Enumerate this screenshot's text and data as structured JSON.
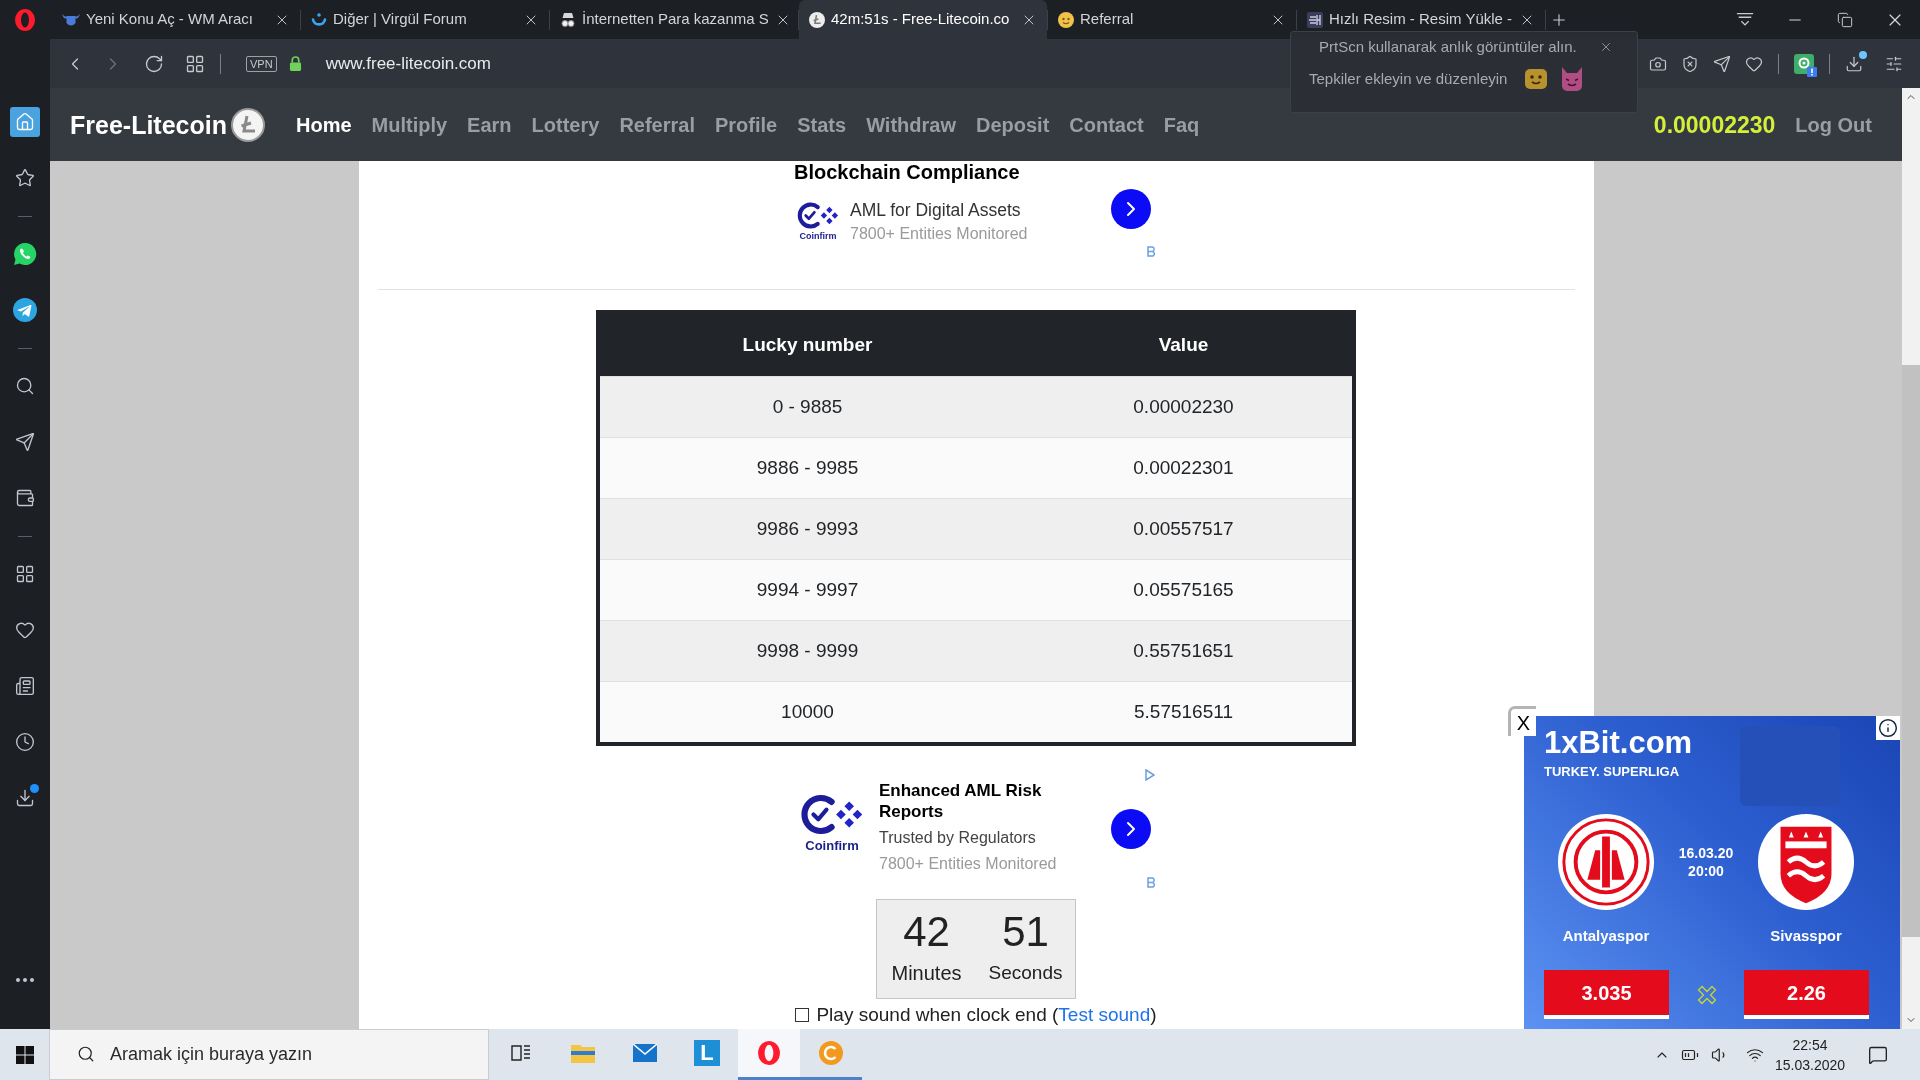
{
  "browser": {
    "tabs": [
      {
        "title": "Yeni Konu Aç - WM Aracı",
        "selected": false
      },
      {
        "title": "Diğer | Virgül Forum",
        "selected": false
      },
      {
        "title": "İnternetten Para kazanma S",
        "selected": false
      },
      {
        "title": "42m:51s - Free-Litecoin.co",
        "selected": true
      },
      {
        "title": "Referral",
        "selected": false
      },
      {
        "title": "Hızlı Resim - Resim Yükle -",
        "selected": false
      }
    ],
    "address_bar": {
      "vpn": "VPN",
      "url": "www.free-litecoin.com"
    },
    "toolbar": [
      [
        {
          "kind": "camera",
          "badge": false
        },
        {
          "kind": "adblock",
          "badge": false
        },
        {
          "kind": "send",
          "badge": false
        },
        {
          "kind": "heart",
          "badge": false
        }
      ],
      [
        {
          "kind": "extension",
          "badge": true
        }
      ],
      [
        {
          "kind": "download",
          "badge": true
        },
        {
          "kind": "settings",
          "badge": false
        }
      ]
    ],
    "popup": {
      "line_1": "PrtScn kullanarak anlık görüntüler alın.",
      "line_2": "Tepkiler ekleyin ve düzenleyin"
    },
    "sidebar": [
      [
        {
          "kind": "home",
          "selected": true,
          "badge": false
        },
        {
          "kind": "star",
          "selected": false,
          "badge": false
        }
      ],
      [
        {
          "kind": "whatsapp",
          "selected": false,
          "badge": false
        },
        {
          "kind": "telegram",
          "selected": false,
          "badge": false
        }
      ],
      [
        {
          "kind": "search",
          "selected": false,
          "badge": false
        },
        {
          "kind": "send",
          "selected": false,
          "badge": false
        },
        {
          "kind": "wallet",
          "selected": false,
          "badge": false
        }
      ],
      [
        {
          "kind": "grid",
          "selected": false,
          "badge": false
        },
        {
          "kind": "heart",
          "selected": false,
          "badge": false
        },
        {
          "kind": "news",
          "selected": false,
          "badge": false
        },
        {
          "kind": "clock",
          "selected": false,
          "badge": false
        },
        {
          "kind": "download",
          "selected": false,
          "badge": true
        }
      ]
    ],
    "sidebar_bottom": [
      {
        "kind": "more",
        "selected": false,
        "badge": false
      }
    ]
  },
  "navbar": {
    "brand": "Free-Litecoin",
    "links": [
      {
        "label": "Home",
        "selected": true
      },
      {
        "label": "Multiply",
        "selected": false
      },
      {
        "label": "Earn",
        "selected": false
      },
      {
        "label": "Lottery",
        "selected": false
      },
      {
        "label": "Referral",
        "selected": false
      },
      {
        "label": "Profile",
        "selected": false
      },
      {
        "label": "Stats",
        "selected": false
      },
      {
        "label": "Withdraw",
        "selected": false
      },
      {
        "label": "Deposit",
        "selected": false
      },
      {
        "label": "Contact",
        "selected": false
      },
      {
        "label": "Faq",
        "selected": false
      }
    ],
    "balance": "0.00002230",
    "logout": "Log Out"
  },
  "ad_top": {
    "title": "Blockchain Compliance",
    "brand": "Coinfirm",
    "line_1": "AML for Digital Assets",
    "line_2": "7800+ Entities Monitored"
  },
  "table": {
    "columns": [
      "Lucky number",
      "Value"
    ],
    "rows": [
      [
        "0 - 9885",
        "0.00002230"
      ],
      [
        "9886 - 9985",
        "0.00022301"
      ],
      [
        "9986 - 9993",
        "0.00557517"
      ],
      [
        "9994 - 9997",
        "0.05575165"
      ],
      [
        "9998 - 9999",
        "0.55751651"
      ],
      [
        "10000",
        "5.57516511"
      ]
    ]
  },
  "ad_bottom": {
    "title": "Enhanced AML Risk Reports",
    "brand": "Coinfirm",
    "line_1": "Trusted by Regulators",
    "line_2": "7800+ Entities Monitored"
  },
  "countdown": {
    "minutes": "42",
    "minutes_label": "Minutes",
    "seconds": "51",
    "seconds_label": "Seconds"
  },
  "sound_option": {
    "checked": false,
    "label": "Play sound when clock end (",
    "link": "Test sound",
    "suffix": ")"
  },
  "side_ad": {
    "close": "X",
    "brand": "1xBit.com",
    "league": "TURKEY. SUPERLIGA",
    "date": "16.03.20",
    "time": "20:00",
    "home_team": "Antalyaspor",
    "away_team": "Sivasspor",
    "home_odds": "3.035",
    "away_odds": "2.26"
  },
  "taskbar": {
    "search": {
      "placeholder": "Aramak için buraya yazın"
    },
    "apps": [
      {
        "kind": "task-view",
        "running": false,
        "selected": false
      },
      {
        "kind": "explorer",
        "running": false,
        "selected": false
      },
      {
        "kind": "mail",
        "running": false,
        "selected": false
      },
      {
        "kind": "l-app",
        "glyph": "L",
        "running": false,
        "selected": false
      },
      {
        "kind": "opera",
        "running": true,
        "selected": true
      },
      {
        "kind": "coin-app",
        "running": true,
        "selected": false
      }
    ],
    "clock": {
      "time": "22:54",
      "date": "15.03.2020"
    }
  }
}
